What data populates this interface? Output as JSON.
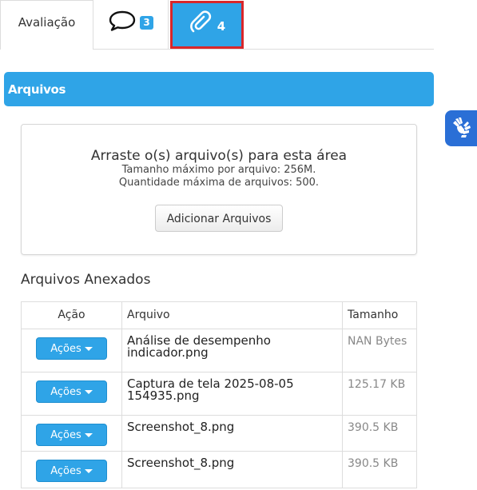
{
  "tabs": {
    "evaluation_label": "Avaliação",
    "comments_count": "3",
    "attachments_count": "4"
  },
  "section_title": "Arquivos",
  "dropzone": {
    "title": "Arraste o(s) arquivo(s) para esta área",
    "max_size": "Tamanho máximo por arquivo: 256M.",
    "max_files": "Quantidade máxima de arquivos: 500.",
    "add_button": "Adicionar Arquivos"
  },
  "attached": {
    "title": "Arquivos Anexados",
    "columns": [
      "Ação",
      "Arquivo",
      "Tamanho"
    ],
    "action_label": "Ações",
    "rows": [
      {
        "name": "Análise de desempenho indicador.png",
        "size": "NAN Bytes"
      },
      {
        "name": "Captura de tela 2025-08-05 154935.png",
        "size": "125.17 KB"
      },
      {
        "name": "Screenshot_8.png",
        "size": "390.5 KB"
      },
      {
        "name": "Screenshot_8.png",
        "size": "390.5 KB"
      }
    ]
  },
  "icons": {
    "comments": "speech-bubble-icon",
    "attachments": "paperclip-icon",
    "accessibility": "sign-language-hands-icon",
    "dropdown": "caret-down-icon"
  },
  "colors": {
    "primary": "#2fa4e7",
    "active_tab_border": "#d9262a",
    "accessibility": "#2a6fd6"
  }
}
